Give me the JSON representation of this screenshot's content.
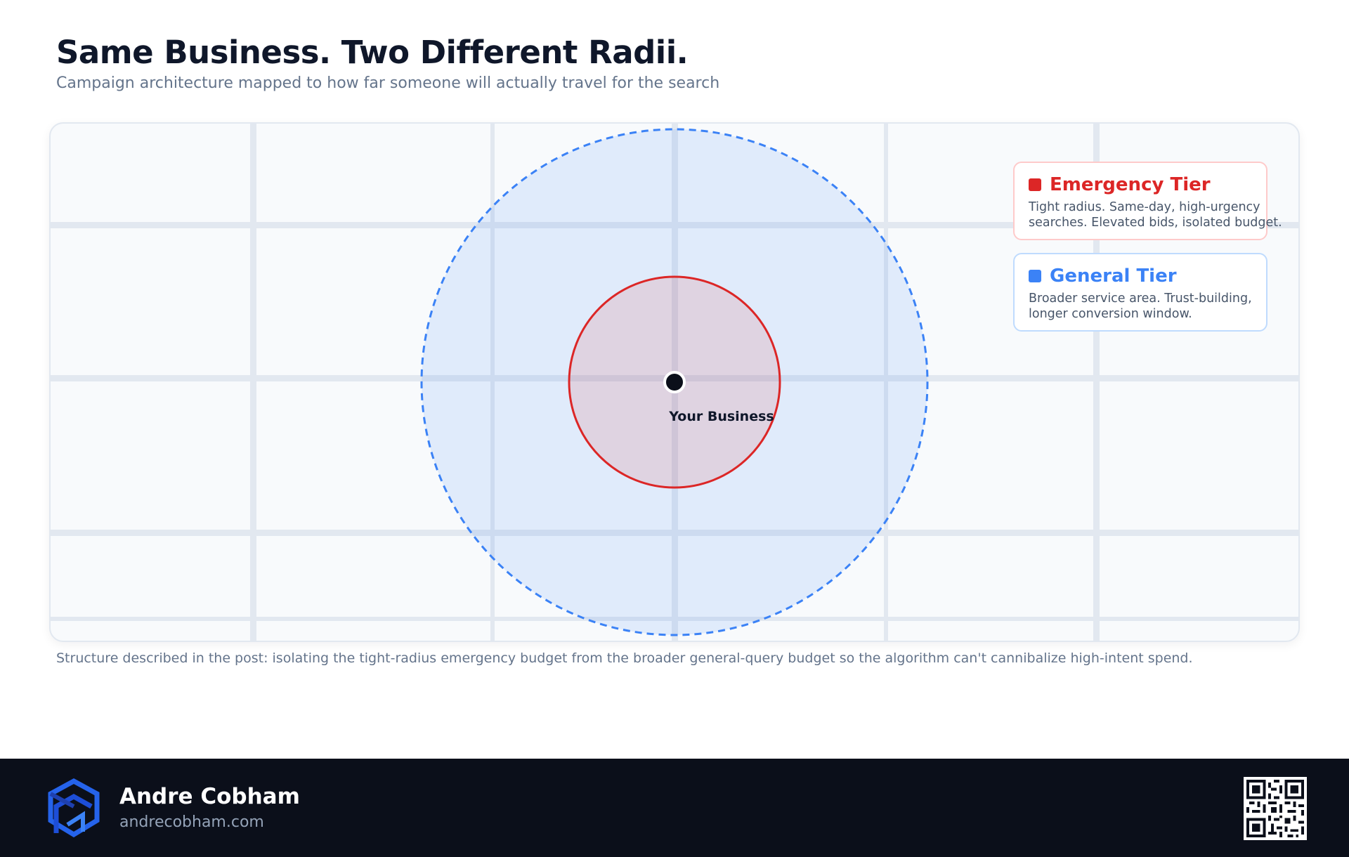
{
  "header": {
    "title": "Same Business. Two Different Radii.",
    "subtitle": "Campaign architecture mapped to how far someone will actually travel for the search"
  },
  "map": {
    "center_label": "Your Business"
  },
  "legend": {
    "emergency": {
      "name": "Emergency Tier",
      "description": "Tight radius. Same-day, high-urgency searches. Elevated bids, isolated budget.",
      "color": "#dc2626"
    },
    "general": {
      "name": "General Tier",
      "description": "Broader service area. Trust-building, longer conversion window.",
      "color": "#3b82f6"
    }
  },
  "caption": "Structure described in the post: isolating the tight-radius emergency budget from the broader general-query budget so the algorithm can't cannibalize high-intent spend.",
  "footer": {
    "author_name": "Andre Cobham",
    "website": "andrecobham.com"
  }
}
